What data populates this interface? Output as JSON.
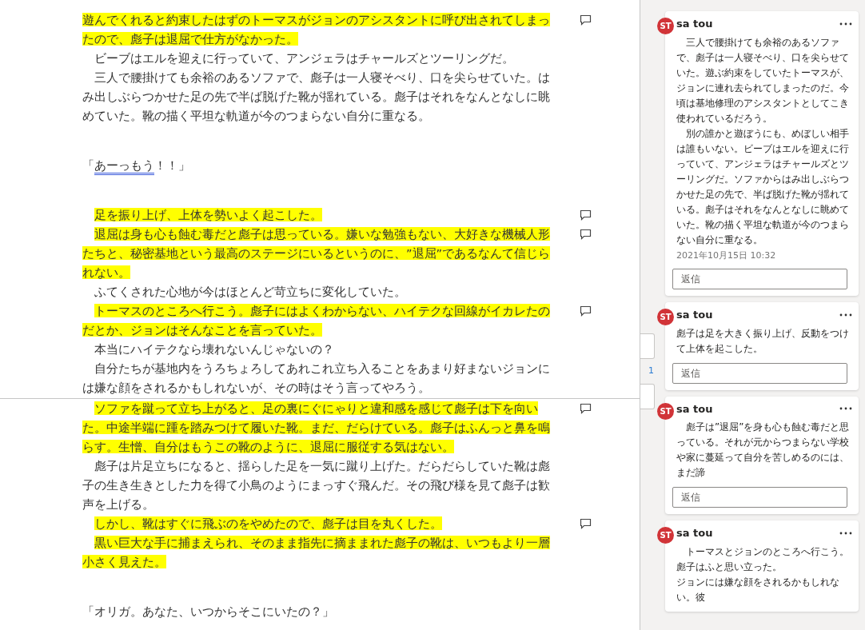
{
  "document": {
    "pages": [
      {
        "paragraphs": [
          {
            "kind": "text",
            "indent": false,
            "highlighted": true,
            "comment": true,
            "text": "遊んでくれると約束したはずのトーマスがジョンのアシスタントに呼び出されてしまったので、彪子は退屈で仕方がなかった。"
          },
          {
            "kind": "text",
            "indent": true,
            "highlighted": false,
            "comment": false,
            "text": "ビーブはエルを迎えに行っていて、アンジェラはチャールズとツーリングだ。"
          },
          {
            "kind": "text",
            "indent": true,
            "highlighted": false,
            "comment": false,
            "text": "三人で腰掛けても余裕のあるソファで、彪子は一人寝そべり、口を尖らせていた。はみ出しぶらつかせた足の先で半ば脱げた靴が揺れている。彪子はそれをなんとなしに眺めていた。靴の描く平坦な軌道が今のつまらない自分に重なる。"
          },
          {
            "kind": "blank"
          },
          {
            "kind": "blank"
          },
          {
            "kind": "dialogue",
            "segments": [
              {
                "text": "「",
                "flagged": false
              },
              {
                "text": "あーっもう",
                "flagged": true
              },
              {
                "text": "！！」",
                "flagged": false
              }
            ]
          },
          {
            "kind": "blank"
          },
          {
            "kind": "blank"
          },
          {
            "kind": "text",
            "indent": true,
            "highlighted": true,
            "comment": true,
            "text": "足を振り上げ、上体を勢いよく起こした。"
          },
          {
            "kind": "text",
            "indent": true,
            "highlighted": true,
            "comment": true,
            "text": "退屈は身も心も蝕む毒だと彪子は思っている。嫌いな勉強もない、大好きな機械人形たちと、秘密基地という最高のステージにいるというのに、”退屈”であるなんて信じられない。"
          },
          {
            "kind": "text",
            "indent": true,
            "highlighted": false,
            "comment": false,
            "text": "ふてくされた心地が今はほとんど苛立ちに変化していた。"
          },
          {
            "kind": "text",
            "indent": true,
            "highlighted": true,
            "comment": true,
            "text": "トーマスのところへ行こう。彪子にはよくわからない、ハイテクな回線がイカレたのだとか、ジョンはそんなことを言っていた。"
          },
          {
            "kind": "text",
            "indent": true,
            "highlighted": false,
            "comment": false,
            "text": "本当にハイテクなら壊れないんじゃないの？"
          },
          {
            "kind": "text",
            "indent": true,
            "highlighted": false,
            "comment": false,
            "text": "自分たちが基地内をうろちょろしてあれこれ立ち入ることをあまり好まないジョンには嫌な顔をされるかもしれないが、その時はそう言ってやろう。"
          }
        ]
      },
      {
        "paragraphs": [
          {
            "kind": "text",
            "indent": true,
            "highlighted": true,
            "comment": true,
            "text": "ソファを蹴って立ち上がると、足の裏にぐにゃりと違和感を感じて彪子は下を向いた。中途半端に踵を踏みつけて履いた靴。まだ、だらけている。彪子はふんっと鼻を鳴らす。生憎、自分はもうこの靴のように、退屈に服従する気はない。"
          },
          {
            "kind": "text",
            "indent": true,
            "highlighted": false,
            "comment": false,
            "text": "彪子は片足立ちになると、揺らした足を一気に蹴り上げた。だらだらしていた靴は彪子の生き生きとした力を得て小鳥のようにまっすぐ飛んだ。その飛び様を見て彪子は歓声を上げる。"
          },
          {
            "kind": "text",
            "indent": true,
            "highlighted": true,
            "comment": true,
            "text": "しかし、靴はすぐに飛ぶのをやめたので、彪子は目を丸くした。"
          },
          {
            "kind": "text",
            "indent": true,
            "highlighted": true,
            "comment": false,
            "text": "黒い巨大な手に捕まえられ、そのまま指先に摘ままれた彪子の靴は、いつもより一層小さく見えた。"
          },
          {
            "kind": "blank"
          },
          {
            "kind": "blank"
          },
          {
            "kind": "dialogue",
            "segments": [
              {
                "text": "「オリガ。あなた、いつからそこにいたの？」",
                "flagged": false
              }
            ]
          }
        ]
      }
    ]
  },
  "comments_pane": {
    "page_marker": "1",
    "comments": [
      {
        "avatar": "ST",
        "author": "sa tou",
        "paragraphs": [
          "　三人で腰掛けても余裕のあるソファで、彪子は一人寝そべり、口を尖らせていた。遊ぶ約束をしていたトーマスが、ジョンに連れ去られてしまったのだ。今頃は基地修理のアシスタントとしてこき使われているだろう。",
          "　別の誰かと遊ぼうにも、めぼしい相手は誰もいない。ビーブはエルを迎えに行っていて、アンジェラはチャールズとツーリングだ。ソファからはみ出しぶらつかせた足の先で、半ば脱げた靴が揺れている。彪子はそれをなんとなしに眺めていた。靴の描く平坦な軌道が今のつまらない自分に重なる。"
        ],
        "date": "2021年10月15日 10:32",
        "reply_placeholder": "返信"
      },
      {
        "avatar": "ST",
        "author": "sa tou",
        "paragraphs": [
          "彪子は足を大きく振り上げ、反動をつけて上体を起こした。"
        ],
        "reply_placeholder": "返信"
      },
      {
        "avatar": "ST",
        "author": "sa tou",
        "paragraphs": [
          "　彪子は”退屈”を身も心も蝕む毒だと思っている。それが元からつまらない学校や家に蔓延って自分を苦しめるのには、まだ諦"
        ],
        "reply_placeholder": "返信"
      },
      {
        "avatar": "ST",
        "author": "sa tou",
        "paragraphs": [
          "　トーマスとジョンのところへ行こう。彪子はふと思い立った。",
          "ジョンには嫌な顔をされるかもしれない。彼"
        ]
      }
    ]
  }
}
